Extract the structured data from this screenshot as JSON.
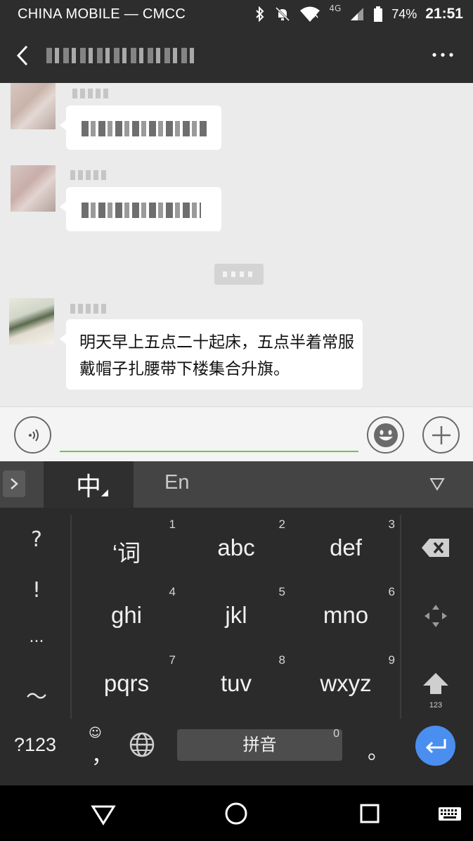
{
  "status_bar": {
    "carrier": "CHINA MOBILE — CMCC",
    "network": "4G",
    "battery": "74%",
    "time": "21:51",
    "icons": [
      "bluetooth-icon",
      "notifications-off-icon",
      "wifi-icon",
      "signal-icon",
      "battery-icon"
    ]
  },
  "title_bar": {
    "back_icon": "back-arrow-icon",
    "more_icon": "more-icon"
  },
  "chat": {
    "messages": [
      {
        "sender": "blurred",
        "type": "text-blurred"
      },
      {
        "sender": "blurred",
        "type": "text-blurred"
      },
      {
        "sender": "blurred",
        "type": "text",
        "text": "明天早上五点二十起床，五点半着常服戴帽子扎腰带下楼集合升旗。"
      }
    ]
  },
  "input_bar": {
    "voice_icon": "voice-input-icon",
    "emoji_icon": "emoji-icon",
    "plus_icon": "plus-icon",
    "value": ""
  },
  "keyboard": {
    "tabs": [
      "中",
      "En"
    ],
    "symbols": [
      "?",
      "!",
      "...",
      "～"
    ],
    "keys": [
      {
        "num": "1",
        "label": "‘词"
      },
      {
        "num": "2",
        "label": "abc"
      },
      {
        "num": "3",
        "label": "def"
      },
      {
        "num": "4",
        "label": "ghi"
      },
      {
        "num": "5",
        "label": "jkl"
      },
      {
        "num": "6",
        "label": "mno"
      },
      {
        "num": "7",
        "label": "pqrs"
      },
      {
        "num": "8",
        "label": "tuv"
      },
      {
        "num": "9",
        "label": "wxyz"
      }
    ],
    "shift_sub": "123",
    "bottom": {
      "num_switch": "?123",
      "emoji_mini": "☺",
      "comma": "，",
      "space": "拼音",
      "space_num": "0",
      "period": "。"
    }
  },
  "nav_bar": {
    "icons": [
      "back-triangle-icon",
      "home-circle-icon",
      "recents-square-icon",
      "keyboard-icon"
    ]
  }
}
